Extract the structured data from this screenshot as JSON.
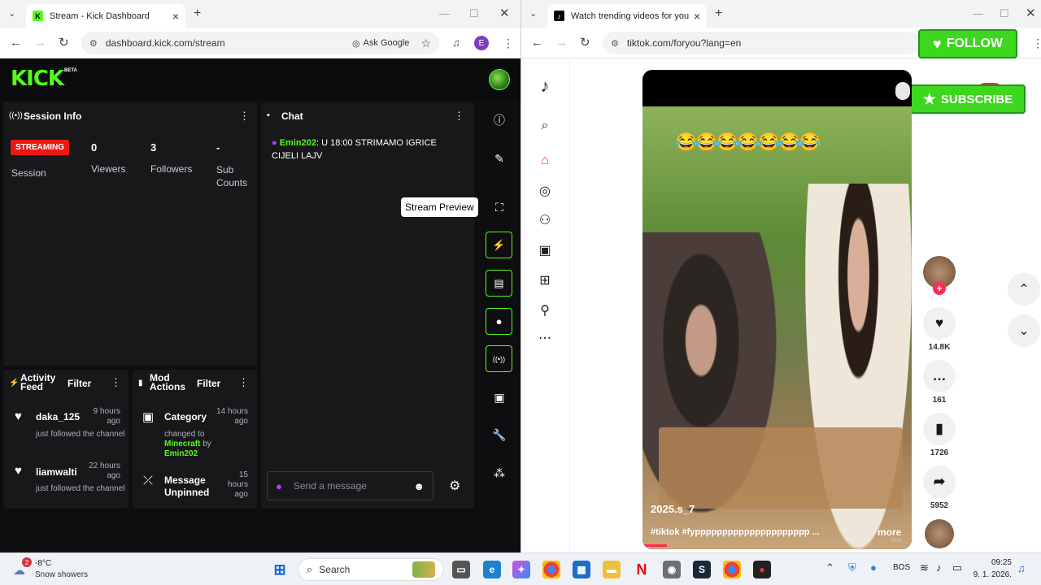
{
  "left_browser": {
    "tab_title": "Stream - Kick Dashboard",
    "url": "dashboard.kick.com/stream",
    "ask_google": "Ask Google",
    "profile_initial": "E"
  },
  "kick": {
    "logo": "KICK",
    "beta": "BETA",
    "session": {
      "title": "Session Info",
      "status_badge": "STREAMING",
      "session_label": "Session",
      "viewers_value": "0",
      "viewers_label": "Viewers",
      "followers_value": "3",
      "followers_label": "Followers",
      "subs_value": "-",
      "subs_label": "Sub Counts"
    },
    "chat": {
      "title": "Chat",
      "message_user": "Emin202",
      "message_text": ": U 18:00 STRIMAMO IGRICE CIJELI LAJV",
      "input_placeholder": "Send a message"
    },
    "tooltip": "Stream Preview",
    "activity": {
      "title": "Activity Feed",
      "filter": "Filter",
      "items": [
        {
          "user": "daka_125",
          "time": "9 hours ago",
          "action": "just followed the channel"
        },
        {
          "user": "liamwalti",
          "time": "22 hours ago",
          "action": "just followed the channel"
        }
      ]
    },
    "mod_actions": {
      "title": "Mod Actions",
      "filter": "Filter",
      "items": [
        {
          "title": "Category",
          "time": "14 hours ago",
          "desc_prefix": "changed to",
          "category": "Minecraft",
          "by": "by",
          "user": "Emin202"
        },
        {
          "title": "Message Unpinned",
          "time": "15 hours ago"
        }
      ]
    }
  },
  "right_browser": {
    "tab_title": "Watch trending videos for you",
    "url": "tiktok.com/foryou?lang=en",
    "follow_overlay": "FOLLOW",
    "subscribe_overlay": "SUBSCRIBE"
  },
  "tiktok": {
    "video_emojis": "😂😂😂😂😂😂😂",
    "video_author": "2025.s_7",
    "video_caption": "#tiktok #fyppppppppppppppppppppp ...",
    "more": "more",
    "veo": "Veo",
    "likes": "14.8K",
    "comments": "161",
    "saves": "1726",
    "shares": "5952"
  },
  "taskbar": {
    "weather_temp": "-8°C",
    "weather_desc": "Snow showers",
    "weather_badge": "2",
    "search_label": "Search",
    "lang": "BOS",
    "time": "09:25",
    "date": "9. 1. 2026."
  },
  "colors": {
    "kick_green": "#53fc18",
    "streaming_red": "#e91916",
    "tiktok_red": "#fe2c55"
  }
}
